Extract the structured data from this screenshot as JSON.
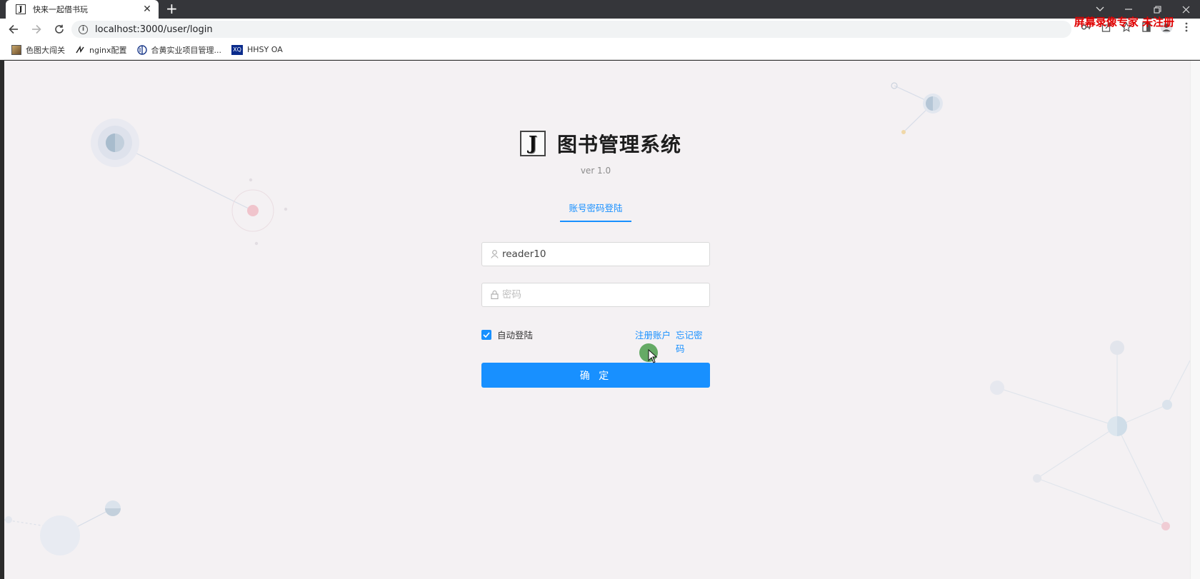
{
  "browser": {
    "tab_title": "快来一起借书玩",
    "tab_favicon_letter": "J",
    "close_glyph": "✕",
    "new_tab_glyph": "+",
    "url": "localhost:3000/user/login",
    "watermark": "屏幕录像专家 未注册",
    "bookmarks": [
      {
        "label": "色图大闯关",
        "icon": "image-icon"
      },
      {
        "label": "nginx配置",
        "icon": "nginx-icon"
      },
      {
        "label": "合黄实业项目管理...",
        "icon": "project-icon"
      },
      {
        "label": "HHSY OA",
        "icon": "xq-icon",
        "icon_text": "XQ"
      }
    ]
  },
  "login": {
    "logo_letter": "J",
    "title": "图书管理系统",
    "version": "ver 1.0",
    "tab_label": "账号密码登陆",
    "username_value": "reader10",
    "password_placeholder": "密码",
    "remember_label": "自动登陆",
    "remember_checked": true,
    "register_link": "注册账户",
    "forgot_link": "忘记密码",
    "submit_label": "确 定"
  },
  "colors": {
    "accent": "#1890ff",
    "page_background": "#f4f1f3"
  }
}
